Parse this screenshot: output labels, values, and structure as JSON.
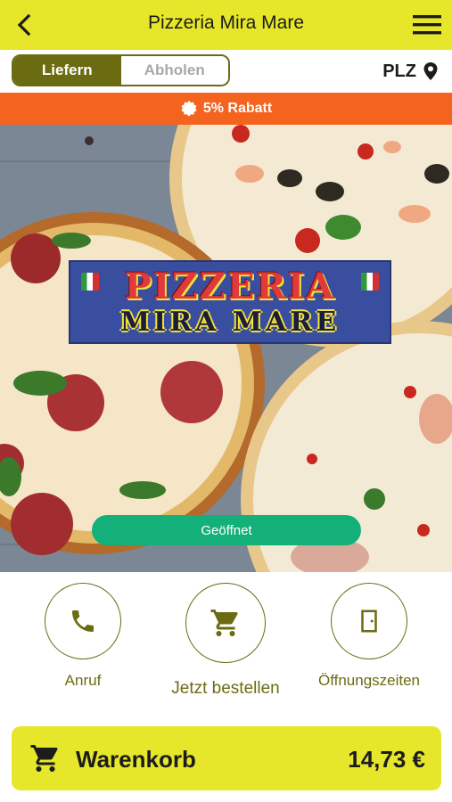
{
  "header": {
    "title": "Pizzeria Mira Mare",
    "back_icon": "arrow-back-icon",
    "menu_icon": "hamburger-menu-icon"
  },
  "order_mode": {
    "options": [
      "Liefern",
      "Abholen"
    ],
    "selected": "Liefern",
    "postal_code_label": "PLZ",
    "postal_code_icon": "location-pin-icon"
  },
  "discount": {
    "icon": "badge-icon",
    "text": "5% Rabatt"
  },
  "restaurant": {
    "logo_line1": "PIZZERIA",
    "logo_line2": "MIRA MARE",
    "status": "Geöffnet"
  },
  "actions": [
    {
      "label": "Anruf",
      "icon": "phone-icon"
    },
    {
      "label": "Jetzt bestellen",
      "icon": "shopping-cart-icon"
    },
    {
      "label": "Öffnungszeiten",
      "icon": "door-icon"
    }
  ],
  "cart": {
    "label": "Warenkorb",
    "total": "14,73 €",
    "icon": "shopping-cart-icon"
  },
  "colors": {
    "primary": "#e6e62a",
    "accent": "#6b6b12",
    "discount": "#f5641e",
    "status_open": "#14b07a"
  }
}
